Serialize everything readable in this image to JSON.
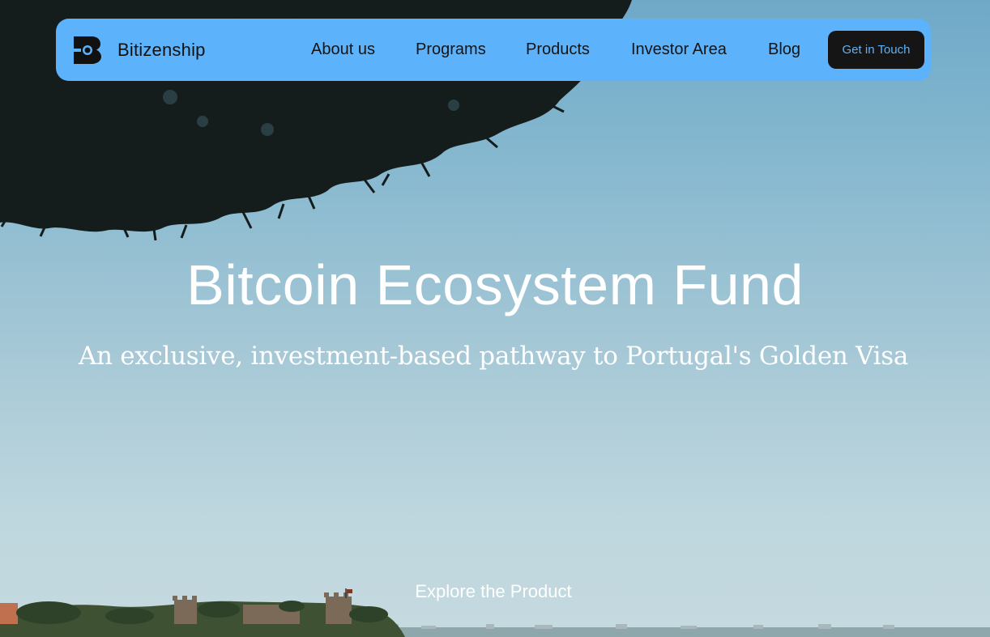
{
  "brand": {
    "name": "Bitizenship",
    "logo_icon": "bitizenship-logo-icon"
  },
  "nav": {
    "items": [
      {
        "label": "About us"
      },
      {
        "label": "Programs"
      },
      {
        "label": "Products"
      },
      {
        "label": "Investor Area"
      },
      {
        "label": "Blog"
      }
    ],
    "cta_label": "Get in Touch"
  },
  "hero": {
    "title": "Bitcoin Ecosystem Fund",
    "subtitle": "An exclusive, investment-based pathway to Portugal's Golden Visa",
    "explore_label": "Explore the Product"
  },
  "colors": {
    "navbar": "#5cb3fb",
    "cta_bg": "#151515",
    "cta_text": "#5cb3fb",
    "sky_top": "#6fa9c8",
    "sky_bottom": "#c5dadf"
  }
}
